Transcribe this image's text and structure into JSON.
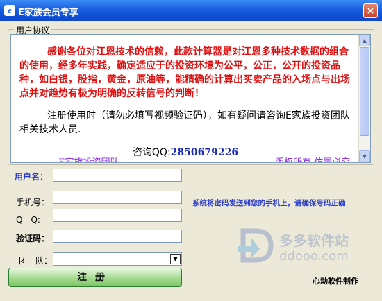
{
  "window": {
    "title": "E家族会员专享",
    "close_glyph": "×",
    "icon_letter": "e"
  },
  "agreement": {
    "group_title": "用户协议",
    "para1": "感谢各位对江恩技术的信赖，此款计算器是对江恩多种技术数据的组合的使用，经多年实践，确定适应于的投资环境为公平，公正，公开的投资品种，如白银，股指，黄金，原油等，能精确的计算出买卖产品的入场点与出场点并对趋势有极为明确的反转信号的判断！",
    "para2": "注册使用时（请勿必填写视频验证码），如有疑问请咨询E家族投资团队相关技术人员.",
    "qq_label": "咨询QQ:",
    "qq_number": "2850679226",
    "footer_left": "E家族投资团队",
    "footer_right": "版权所有 仿冒必究"
  },
  "form": {
    "username_label": "用户名：",
    "username_value": "",
    "phone_label": "手机号：",
    "phone_value": "",
    "qq_label": "Q　Q:",
    "qq_value": "",
    "code_label": "验证码：",
    "code_value": "",
    "team_label": "团　队：",
    "team_value": "",
    "hint": "系统将密码发送到您的手机上，请确保号码正确",
    "register_label": "注册"
  },
  "credit": "心动软件制作",
  "watermark": {
    "cn": "多多软件站",
    "en": "ddooo.com"
  },
  "colors": {
    "titlebar": "#0d4ed3",
    "red_text": "#e01010",
    "blue_label": "#2a3cc8",
    "button_green": "#a9dd95"
  }
}
